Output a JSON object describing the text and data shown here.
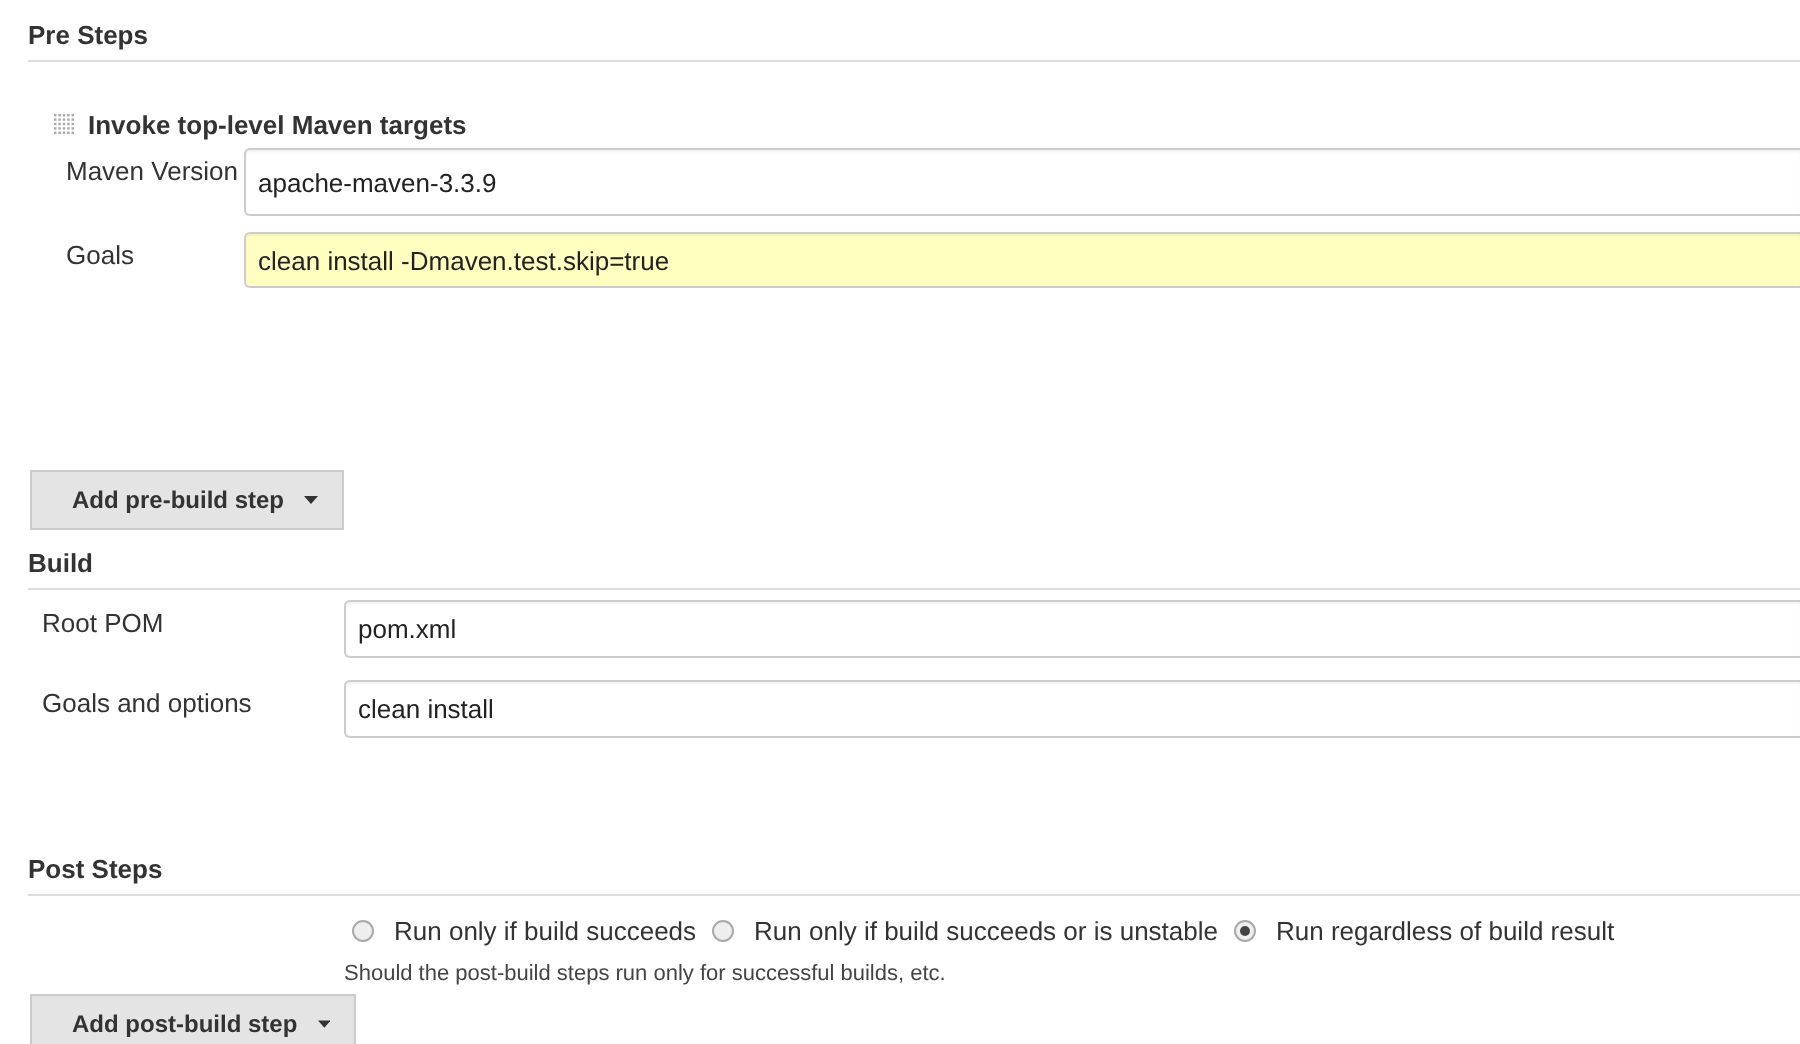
{
  "pre_steps": {
    "title": "Pre Steps",
    "step": {
      "title": "Invoke top-level Maven targets",
      "fields": [
        {
          "label": "Maven Version",
          "value": "apache-maven-3.3.9",
          "highlighted": false
        },
        {
          "label": "Goals",
          "value": "clean install -Dmaven.test.skip=true",
          "highlighted": true
        }
      ]
    },
    "add_button": "Add pre-build step"
  },
  "build": {
    "title": "Build",
    "fields": [
      {
        "label": "Root POM",
        "value": "pom.xml"
      },
      {
        "label": "Goals and options",
        "value": "clean install"
      }
    ]
  },
  "post_steps": {
    "title": "Post Steps",
    "options": [
      {
        "label": "Run only if build succeeds",
        "selected": false
      },
      {
        "label": "Run only if build succeeds or is unstable",
        "selected": false
      },
      {
        "label": "Run regardless of build result",
        "selected": true
      }
    ],
    "help": "Should the post-build steps run only for successful builds, etc.",
    "add_button": "Add post-build step"
  }
}
